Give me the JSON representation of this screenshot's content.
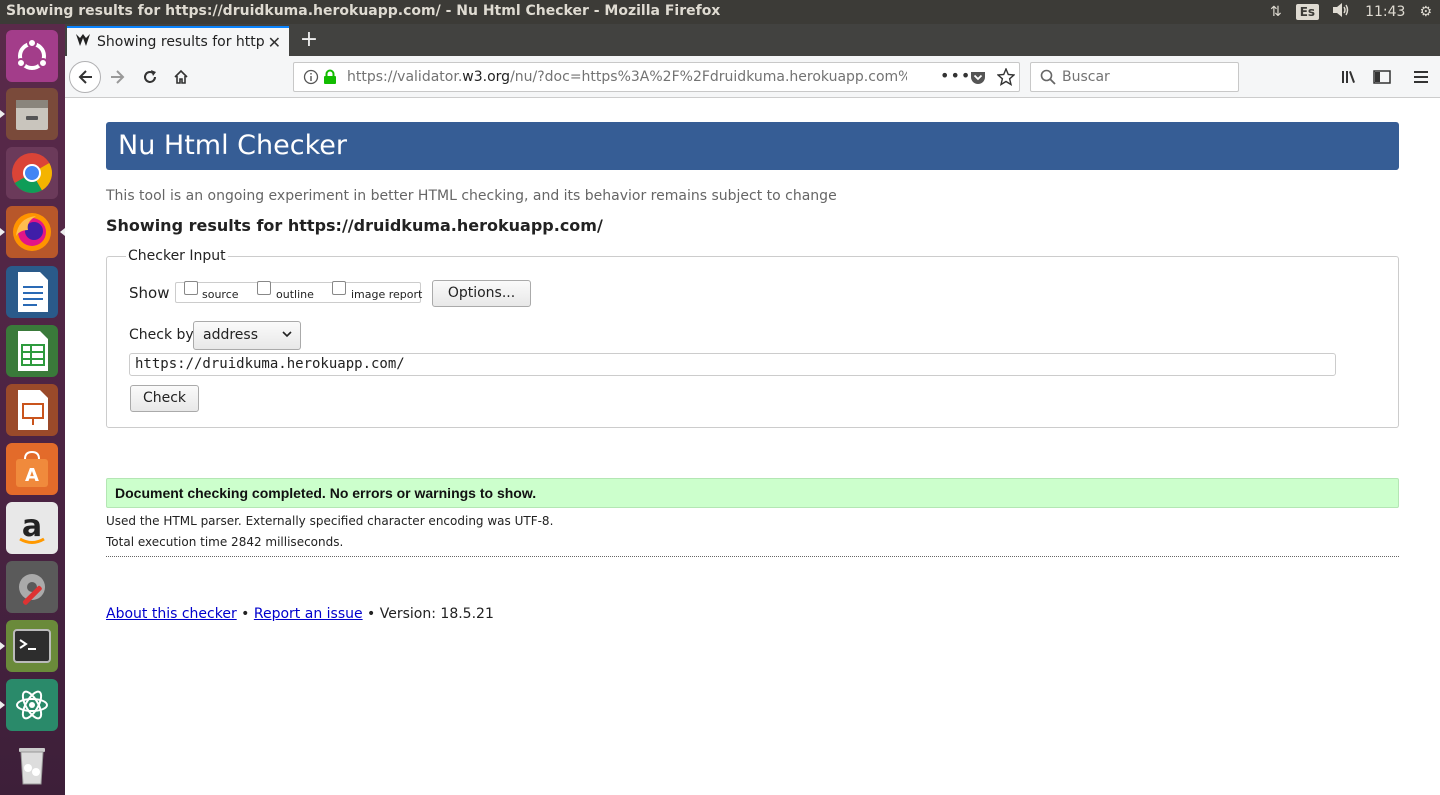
{
  "os": {
    "window_title": "Showing results for https://druidkuma.herokuapp.com/ - Nu Html Checker - Mozilla Firefox",
    "keyboard_layout": "Es",
    "volume": "◂))",
    "time": "11:43"
  },
  "launcher": {
    "items": [
      "ubuntu-dash",
      "files",
      "chrome",
      "firefox",
      "writer",
      "calc",
      "impress",
      "software-center",
      "amazon",
      "system-settings",
      "terminal",
      "atom",
      "trash"
    ]
  },
  "browser": {
    "tab_title": "Showing results for http",
    "url_prefix": "https://validator.",
    "url_domain": "w3.org",
    "url_suffix": "/nu/?doc=https%3A%2F%2Fdruidkuma.herokuapp.com%",
    "search_placeholder": "Buscar"
  },
  "page": {
    "title": "Nu Html Checker",
    "tagline": "This tool is an ongoing experiment in better HTML checking, and its behavior remains subject to change",
    "results_heading": "Showing results for https://druidkuma.herokuapp.com/",
    "fieldset_legend": "Checker Input",
    "show_label": "Show",
    "checkboxes": [
      "source",
      "outline",
      "image report"
    ],
    "options_button": "Options...",
    "check_by_label": "Check by",
    "check_by_value": "address",
    "url_value": "https://druidkuma.herokuapp.com/",
    "check_button": "Check",
    "success_message": "Document checking completed. No errors or warnings to show.",
    "info_line1": "Used the HTML parser. Externally specified character encoding was UTF-8.",
    "info_line2": "Total execution time 2842 milliseconds.",
    "footer_about": "About this checker",
    "footer_sep1": " • ",
    "footer_report": "Report an issue",
    "footer_version": " • Version: 18.5.21"
  },
  "colors": {
    "banner": "#365d95",
    "success_bg": "#ccffcc",
    "launcher": "#4a2342",
    "os_panel": "#3c3b37"
  }
}
